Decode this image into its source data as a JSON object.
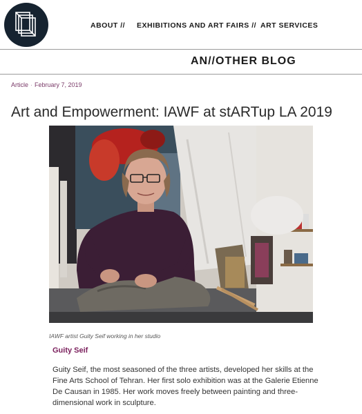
{
  "nav": {
    "items": [
      {
        "label": "ABOUT //"
      },
      {
        "label": "EXHIBITIONS AND ART FAIRS //"
      },
      {
        "label": "ART SERVICES"
      }
    ]
  },
  "blog": {
    "title": "AN//OTHER BLOG"
  },
  "article": {
    "category": "Article",
    "separator": "·",
    "date": "February 7, 2019",
    "title": "Art and Empowerment: IAWF at stARTup LA 2019",
    "photo_caption": "IAWF artist Guity Seif working in her studio",
    "subhead": "Guity Seif",
    "paragraph": "Guity Seif, the most seasoned of the three artists, developed her skills at the Fine Arts School of Tehran. Her first solo exhibition was at the Galerie Etienne De Causan in 1985. Her work moves freely between painting and three-dimensional work in sculpture."
  },
  "colors": {
    "accent": "#7a1f5c",
    "logo_bg": "#162330"
  },
  "icons": {
    "logo": "stacked-frames-logo-icon"
  }
}
